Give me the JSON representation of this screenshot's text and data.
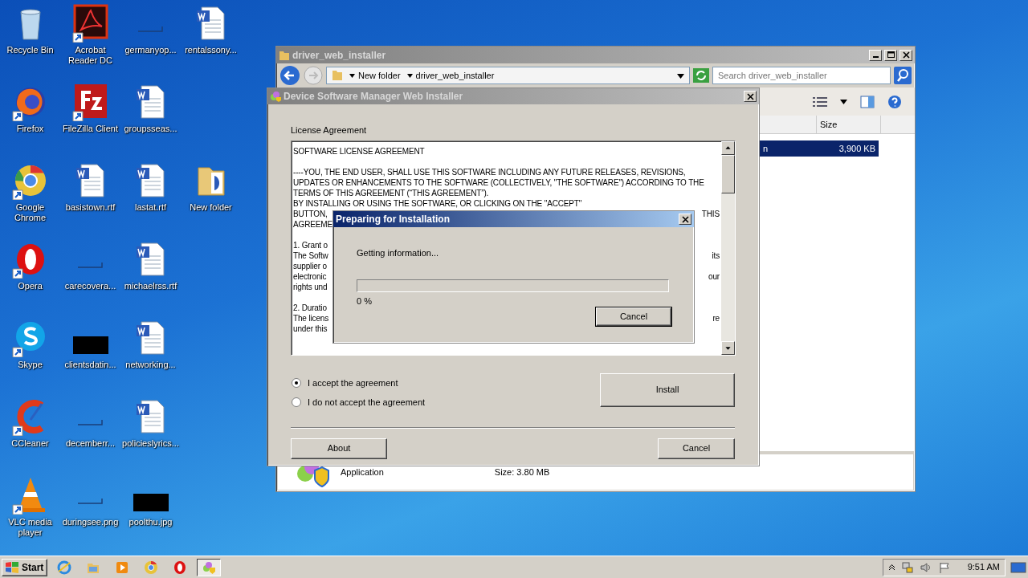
{
  "desktop_rows": [
    [
      {
        "label": "Recycle Bin",
        "kind": "recycle",
        "shortcut": false
      },
      {
        "label": "Acrobat Reader DC",
        "kind": "acrobat",
        "shortcut": true
      },
      {
        "label": "germanyop...",
        "kind": "blank",
        "shortcut": false
      },
      {
        "label": "rentalssony...",
        "kind": "word",
        "shortcut": false
      }
    ],
    [
      {
        "label": "Firefox",
        "kind": "firefox",
        "shortcut": true
      },
      {
        "label": "FileZilla Client",
        "kind": "filezilla",
        "shortcut": true
      },
      {
        "label": "groupsseas...",
        "kind": "word",
        "shortcut": false
      }
    ],
    [
      {
        "label": "Google Chrome",
        "kind": "chrome",
        "shortcut": true
      },
      {
        "label": "basistown.rtf",
        "kind": "word",
        "shortcut": false
      },
      {
        "label": "lastat.rtf",
        "kind": "word",
        "shortcut": false
      },
      {
        "label": "New folder",
        "kind": "folder",
        "shortcut": false
      }
    ],
    [
      {
        "label": "Opera",
        "kind": "opera",
        "shortcut": true
      },
      {
        "label": "carecovera...",
        "kind": "blank",
        "shortcut": false
      },
      {
        "label": "michaelrss.rtf",
        "kind": "word",
        "shortcut": false
      }
    ],
    [
      {
        "label": "Skype",
        "kind": "skype",
        "shortcut": true
      },
      {
        "label": "clientsdatin...",
        "kind": "dark",
        "shortcut": false
      },
      {
        "label": "networking...",
        "kind": "word",
        "shortcut": false
      }
    ],
    [
      {
        "label": "CCleaner",
        "kind": "ccleaner",
        "shortcut": true
      },
      {
        "label": "decemberr...",
        "kind": "blank",
        "shortcut": false
      },
      {
        "label": "policieslyrics...",
        "kind": "word",
        "shortcut": false
      }
    ],
    [
      {
        "label": "VLC media player",
        "kind": "vlc",
        "shortcut": true
      },
      {
        "label": "duringsee.png",
        "kind": "blank",
        "shortcut": false
      },
      {
        "label": "poolthu.jpg",
        "kind": "dark",
        "shortcut": false
      }
    ]
  ],
  "explorer": {
    "title": "driver_web_installer",
    "breadcrumbs": [
      "New folder",
      "driver_web_installer"
    ],
    "search": {
      "placeholder": "Search driver_web_installer"
    },
    "columns": [
      "Size"
    ],
    "rows": [
      {
        "name": "n",
        "size": "3,900 KB",
        "selected": true
      }
    ],
    "details": {
      "type": "Application",
      "size": "Size: 3.80 MB"
    }
  },
  "installer": {
    "title": "Device Software Manager Web Installer",
    "heading": "License Agreement",
    "license": [
      [
        {
          "left": "SOFTWARE LICENSE AGREEMENT"
        }
      ],
      [
        {
          "left": "----YOU, THE END USER, SHALL USE THIS SOFTWARE INCLUDING ANY FUTURE RELEASES, REVISIONS,"
        },
        {
          "left": "UPDATES OR ENHANCEMENTS TO THE SOFTWARE (COLLECTIVELY, \"THE SOFTWARE\") ACCORDING TO THE"
        },
        {
          "left": "TERMS OF THIS AGREEMENT (“THIS AGREEMENT”)."
        },
        {
          "left": "BY INSTALLING OR USING THE SOFTWARE, OR CLICKING ON THE \"ACCEPT\""
        },
        {
          "left": "BUTTON,",
          "right": "THIS"
        },
        {
          "left": "AGREEME"
        }
      ],
      [
        {
          "left": "1. Grant o"
        },
        {
          "left": "The Softw",
          "right": "its"
        },
        {
          "left": "supplier o"
        },
        {
          "left": "electronic",
          "right": "our"
        },
        {
          "left": "rights und"
        }
      ],
      [
        {
          "left": "2. Duratio"
        },
        {
          "left": "The licens",
          "right": "re"
        },
        {
          "left": "under this"
        }
      ]
    ],
    "options": [
      {
        "label": "I accept the agreement",
        "selected": true
      },
      {
        "label": "I do not accept the agreement",
        "selected": false
      }
    ],
    "install_button": "Install",
    "about_button": "About",
    "cancel_button": "Cancel"
  },
  "progress": {
    "title": "Preparing for Installation",
    "message": "Getting information...",
    "level": 0,
    "reading": "0 %",
    "cancel_button": "Cancel"
  },
  "taskbar": {
    "start": "Start",
    "apps": [
      {
        "kind": "ie",
        "selected": false
      },
      {
        "kind": "explorer",
        "selected": false
      },
      {
        "kind": "media",
        "selected": false
      },
      {
        "kind": "chrome",
        "selected": false
      },
      {
        "kind": "opera",
        "selected": false
      },
      {
        "kind": "installer",
        "selected": true
      }
    ],
    "time": "9:51 AM"
  }
}
